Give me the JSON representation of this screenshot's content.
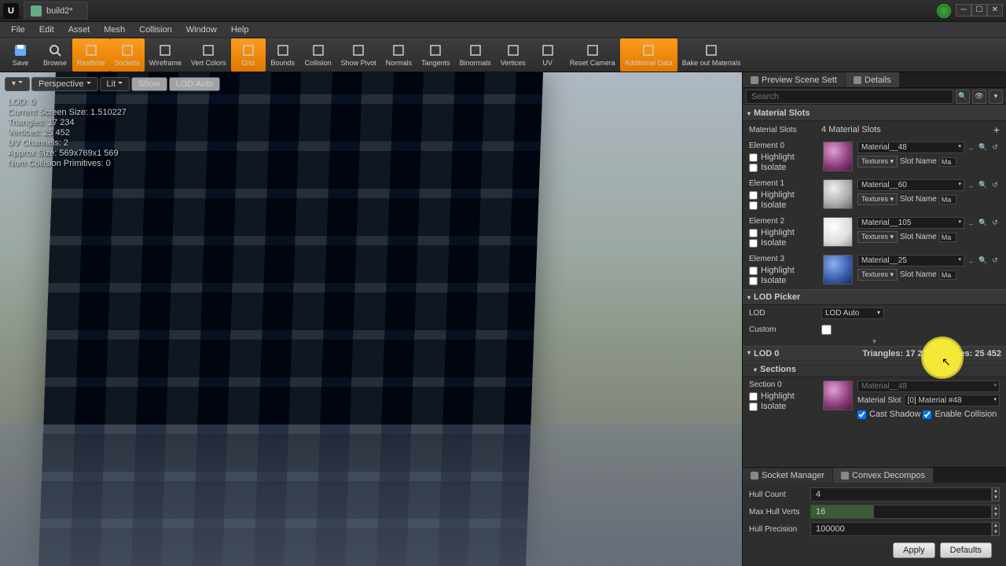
{
  "window": {
    "title": "build2*"
  },
  "menu": [
    "File",
    "Edit",
    "Asset",
    "Mesh",
    "Collision",
    "Window",
    "Help"
  ],
  "toolbar": [
    {
      "label": "Save",
      "icon": "save",
      "active": false
    },
    {
      "label": "Browse",
      "icon": "browse",
      "active": false
    },
    {
      "label": "Realtime",
      "icon": "realtime",
      "active": true
    },
    {
      "label": "Sockets",
      "icon": "sockets",
      "active": true
    },
    {
      "label": "Wireframe",
      "icon": "wireframe",
      "active": false
    },
    {
      "label": "Vert Colors",
      "icon": "vertcolors",
      "active": false
    },
    {
      "label": "Grid",
      "icon": "grid",
      "active": true
    },
    {
      "label": "Bounds",
      "icon": "bounds",
      "active": false
    },
    {
      "label": "Collision",
      "icon": "collision",
      "active": false
    },
    {
      "label": "Show Pivot",
      "icon": "pivot",
      "active": false
    },
    {
      "label": "Normals",
      "icon": "normals",
      "active": false
    },
    {
      "label": "Tangents",
      "icon": "tangents",
      "active": false
    },
    {
      "label": "Binormals",
      "icon": "binormals",
      "active": false
    },
    {
      "label": "Vertices",
      "icon": "vertices",
      "active": false
    },
    {
      "label": "UV",
      "icon": "uv",
      "active": false
    },
    {
      "label": "Reset Camera",
      "icon": "resetcam",
      "active": false
    },
    {
      "label": "Additional Data",
      "icon": "adddata",
      "active": true
    },
    {
      "label": "Bake out Materials",
      "icon": "bake",
      "active": false
    }
  ],
  "viewport": {
    "buttons": {
      "perspective": "Perspective",
      "lit": "Lit",
      "show": "Show",
      "lod": "LOD Auto"
    },
    "stats": {
      "lod": "LOD:  0",
      "screen": "Current Screen Size: 1.510227",
      "tris": "Triangles: 17 234",
      "verts": "Vertices: 25 452",
      "uvch": "UV Channels: 2",
      "approx": "Approx Size: 569x769x1 569",
      "collprim": "Num Collision Primitives: 0"
    }
  },
  "details": {
    "tabs": {
      "preview": "Preview Scene Sett",
      "details": "Details"
    },
    "search_placeholder": "Search",
    "material_slots": {
      "header": "Material Slots",
      "label": "Material Slots",
      "count": "4 Material Slots",
      "elements": [
        {
          "name": "Element 0",
          "mat": "Material__48",
          "thumb": "purple"
        },
        {
          "name": "Element 1",
          "mat": "Material__60",
          "thumb": "grey"
        },
        {
          "name": "Element 2",
          "mat": "Material__105",
          "thumb": "white"
        },
        {
          "name": "Element 3",
          "mat": "Material__25",
          "thumb": "blue"
        }
      ],
      "highlight": "Highlight",
      "isolate": "Isolate",
      "textures": "Textures",
      "slotname": "Slot Name",
      "slotval": "Ma"
    },
    "lod_picker": {
      "header": "LOD Picker",
      "lod_label": "LOD",
      "lod_value": "LOD Auto",
      "custom": "Custom"
    },
    "lod0": {
      "header": "LOD 0",
      "tris": "Triangles: 17 234",
      "verts": "Vertices: 25 452",
      "sections": "Sections",
      "section0": {
        "name": "Section 0",
        "highlight": "Highlight",
        "isolate": "Isolate",
        "mat": "Material__48",
        "matslot_label": "Material Slot",
        "matslot": "[0] Material #48",
        "cast": "Cast Shadow",
        "enable": "Enable Collision"
      }
    }
  },
  "bottom": {
    "tabs": {
      "socket": "Socket Manager",
      "convex": "Convex Decompos"
    },
    "hullcount": {
      "label": "Hull Count",
      "val": "4"
    },
    "maxverts": {
      "label": "Max Hull Verts",
      "val": "16"
    },
    "precision": {
      "label": "Hull Precision",
      "val": "100000"
    },
    "apply": "Apply",
    "defaults": "Defaults"
  }
}
